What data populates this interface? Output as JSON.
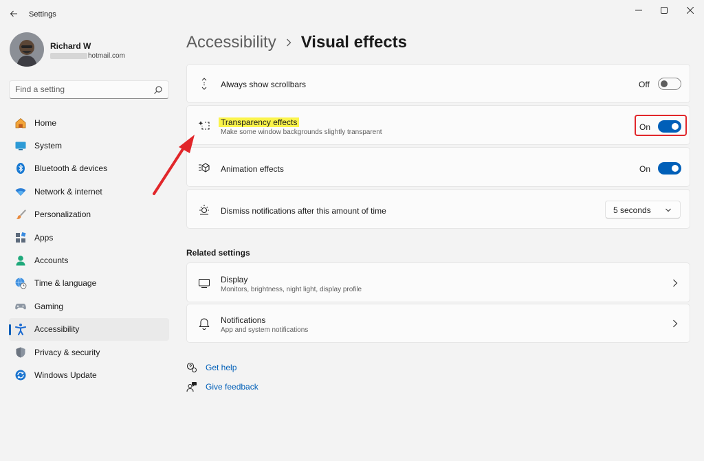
{
  "window": {
    "title": "Settings"
  },
  "profile": {
    "name": "Richard W",
    "email_visible": "hotmail.com"
  },
  "search": {
    "placeholder": "Find a setting"
  },
  "sidebar": {
    "items": [
      {
        "label": "Home",
        "icon": "home-icon",
        "active": false
      },
      {
        "label": "System",
        "icon": "monitor-icon",
        "active": false
      },
      {
        "label": "Bluetooth & devices",
        "icon": "bluetooth-icon",
        "active": false
      },
      {
        "label": "Network & internet",
        "icon": "wifi-icon",
        "active": false
      },
      {
        "label": "Personalization",
        "icon": "brush-icon",
        "active": false
      },
      {
        "label": "Apps",
        "icon": "apps-icon",
        "active": false
      },
      {
        "label": "Accounts",
        "icon": "account-icon",
        "active": false
      },
      {
        "label": "Time & language",
        "icon": "globe-clock-icon",
        "active": false
      },
      {
        "label": "Gaming",
        "icon": "gamepad-icon",
        "active": false
      },
      {
        "label": "Accessibility",
        "icon": "accessibility-icon",
        "active": true
      },
      {
        "label": "Privacy & security",
        "icon": "shield-icon",
        "active": false
      },
      {
        "label": "Windows Update",
        "icon": "update-icon",
        "active": false
      }
    ]
  },
  "breadcrumb": {
    "parent": "Accessibility",
    "current": "Visual effects"
  },
  "settings": {
    "scrollbars": {
      "title": "Always show scrollbars",
      "state_label": "Off",
      "on": false
    },
    "transparency": {
      "title": "Transparency effects",
      "subtitle": "Make some window backgrounds slightly transparent",
      "state_label": "On",
      "on": true
    },
    "animation": {
      "title": "Animation effects",
      "state_label": "On",
      "on": true
    },
    "notifications_time": {
      "title": "Dismiss notifications after this amount of time",
      "value": "5 seconds"
    }
  },
  "related": {
    "heading": "Related settings",
    "items": [
      {
        "title": "Display",
        "subtitle": "Monitors, brightness, night light, display profile"
      },
      {
        "title": "Notifications",
        "subtitle": "App and system notifications"
      }
    ]
  },
  "help": {
    "get_help": "Get help",
    "give_feedback": "Give feedback"
  },
  "colors": {
    "accent": "#005fb8",
    "highlight": "#fbf44b",
    "annotation": "#e1262a"
  }
}
